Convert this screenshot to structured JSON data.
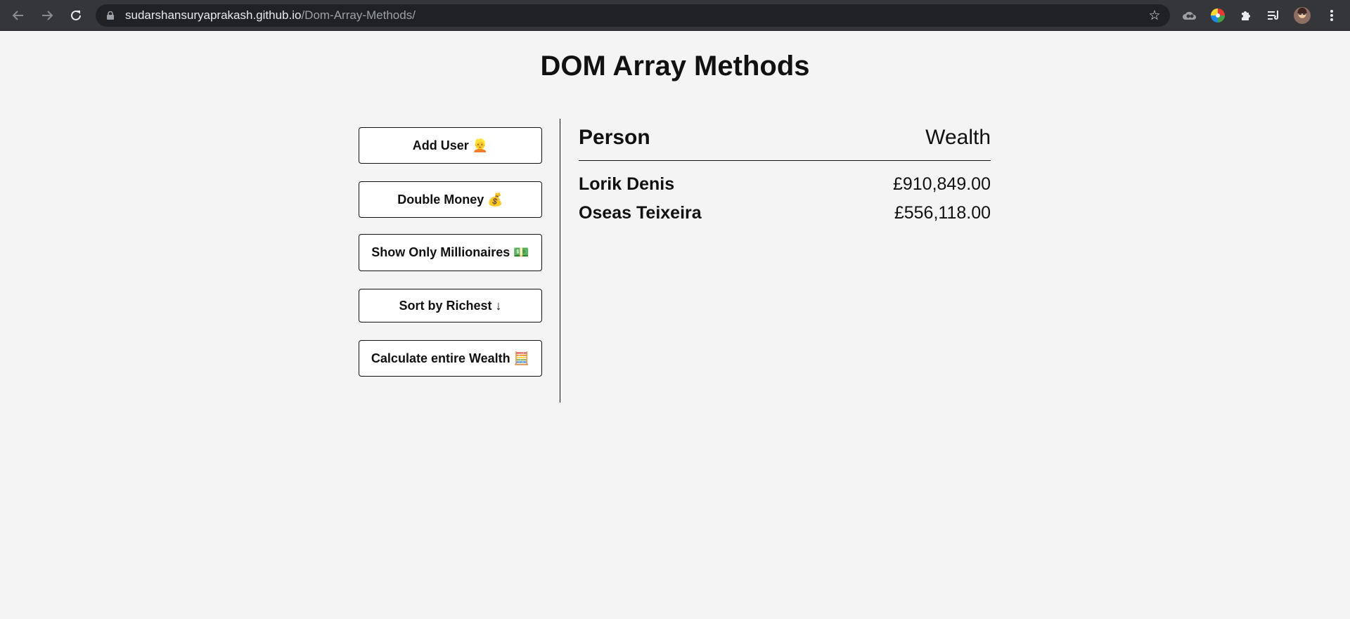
{
  "browser": {
    "url_host": "sudarshansuryaprakash.github.io",
    "url_path": "/Dom-Array-Methods/",
    "back_icon": "arrow-left-icon",
    "forward_icon": "arrow-right-icon",
    "reload_icon": "reload-icon",
    "bookmark_icon": "star-icon"
  },
  "page": {
    "title": "DOM Array Methods"
  },
  "actions": {
    "add_user": "Add User 👱",
    "double_money": "Double Money 💰",
    "show_millionaires": "Show Only Millionaires 💵",
    "sort_richest": "Sort by Richest ↓",
    "calculate_wealth": "Calculate entire Wealth 🧮"
  },
  "table": {
    "heading_person": "Person",
    "heading_wealth": "Wealth",
    "rows": [
      {
        "name": "Lorik Denis",
        "wealth": "£910,849.00"
      },
      {
        "name": "Oseas Teixeira",
        "wealth": "£556,118.00"
      }
    ]
  },
  "colors": {
    "page_bg": "#f4f4f4",
    "chrome_bg": "#35363a",
    "omnibox_bg": "#202124",
    "text": "#111111"
  }
}
